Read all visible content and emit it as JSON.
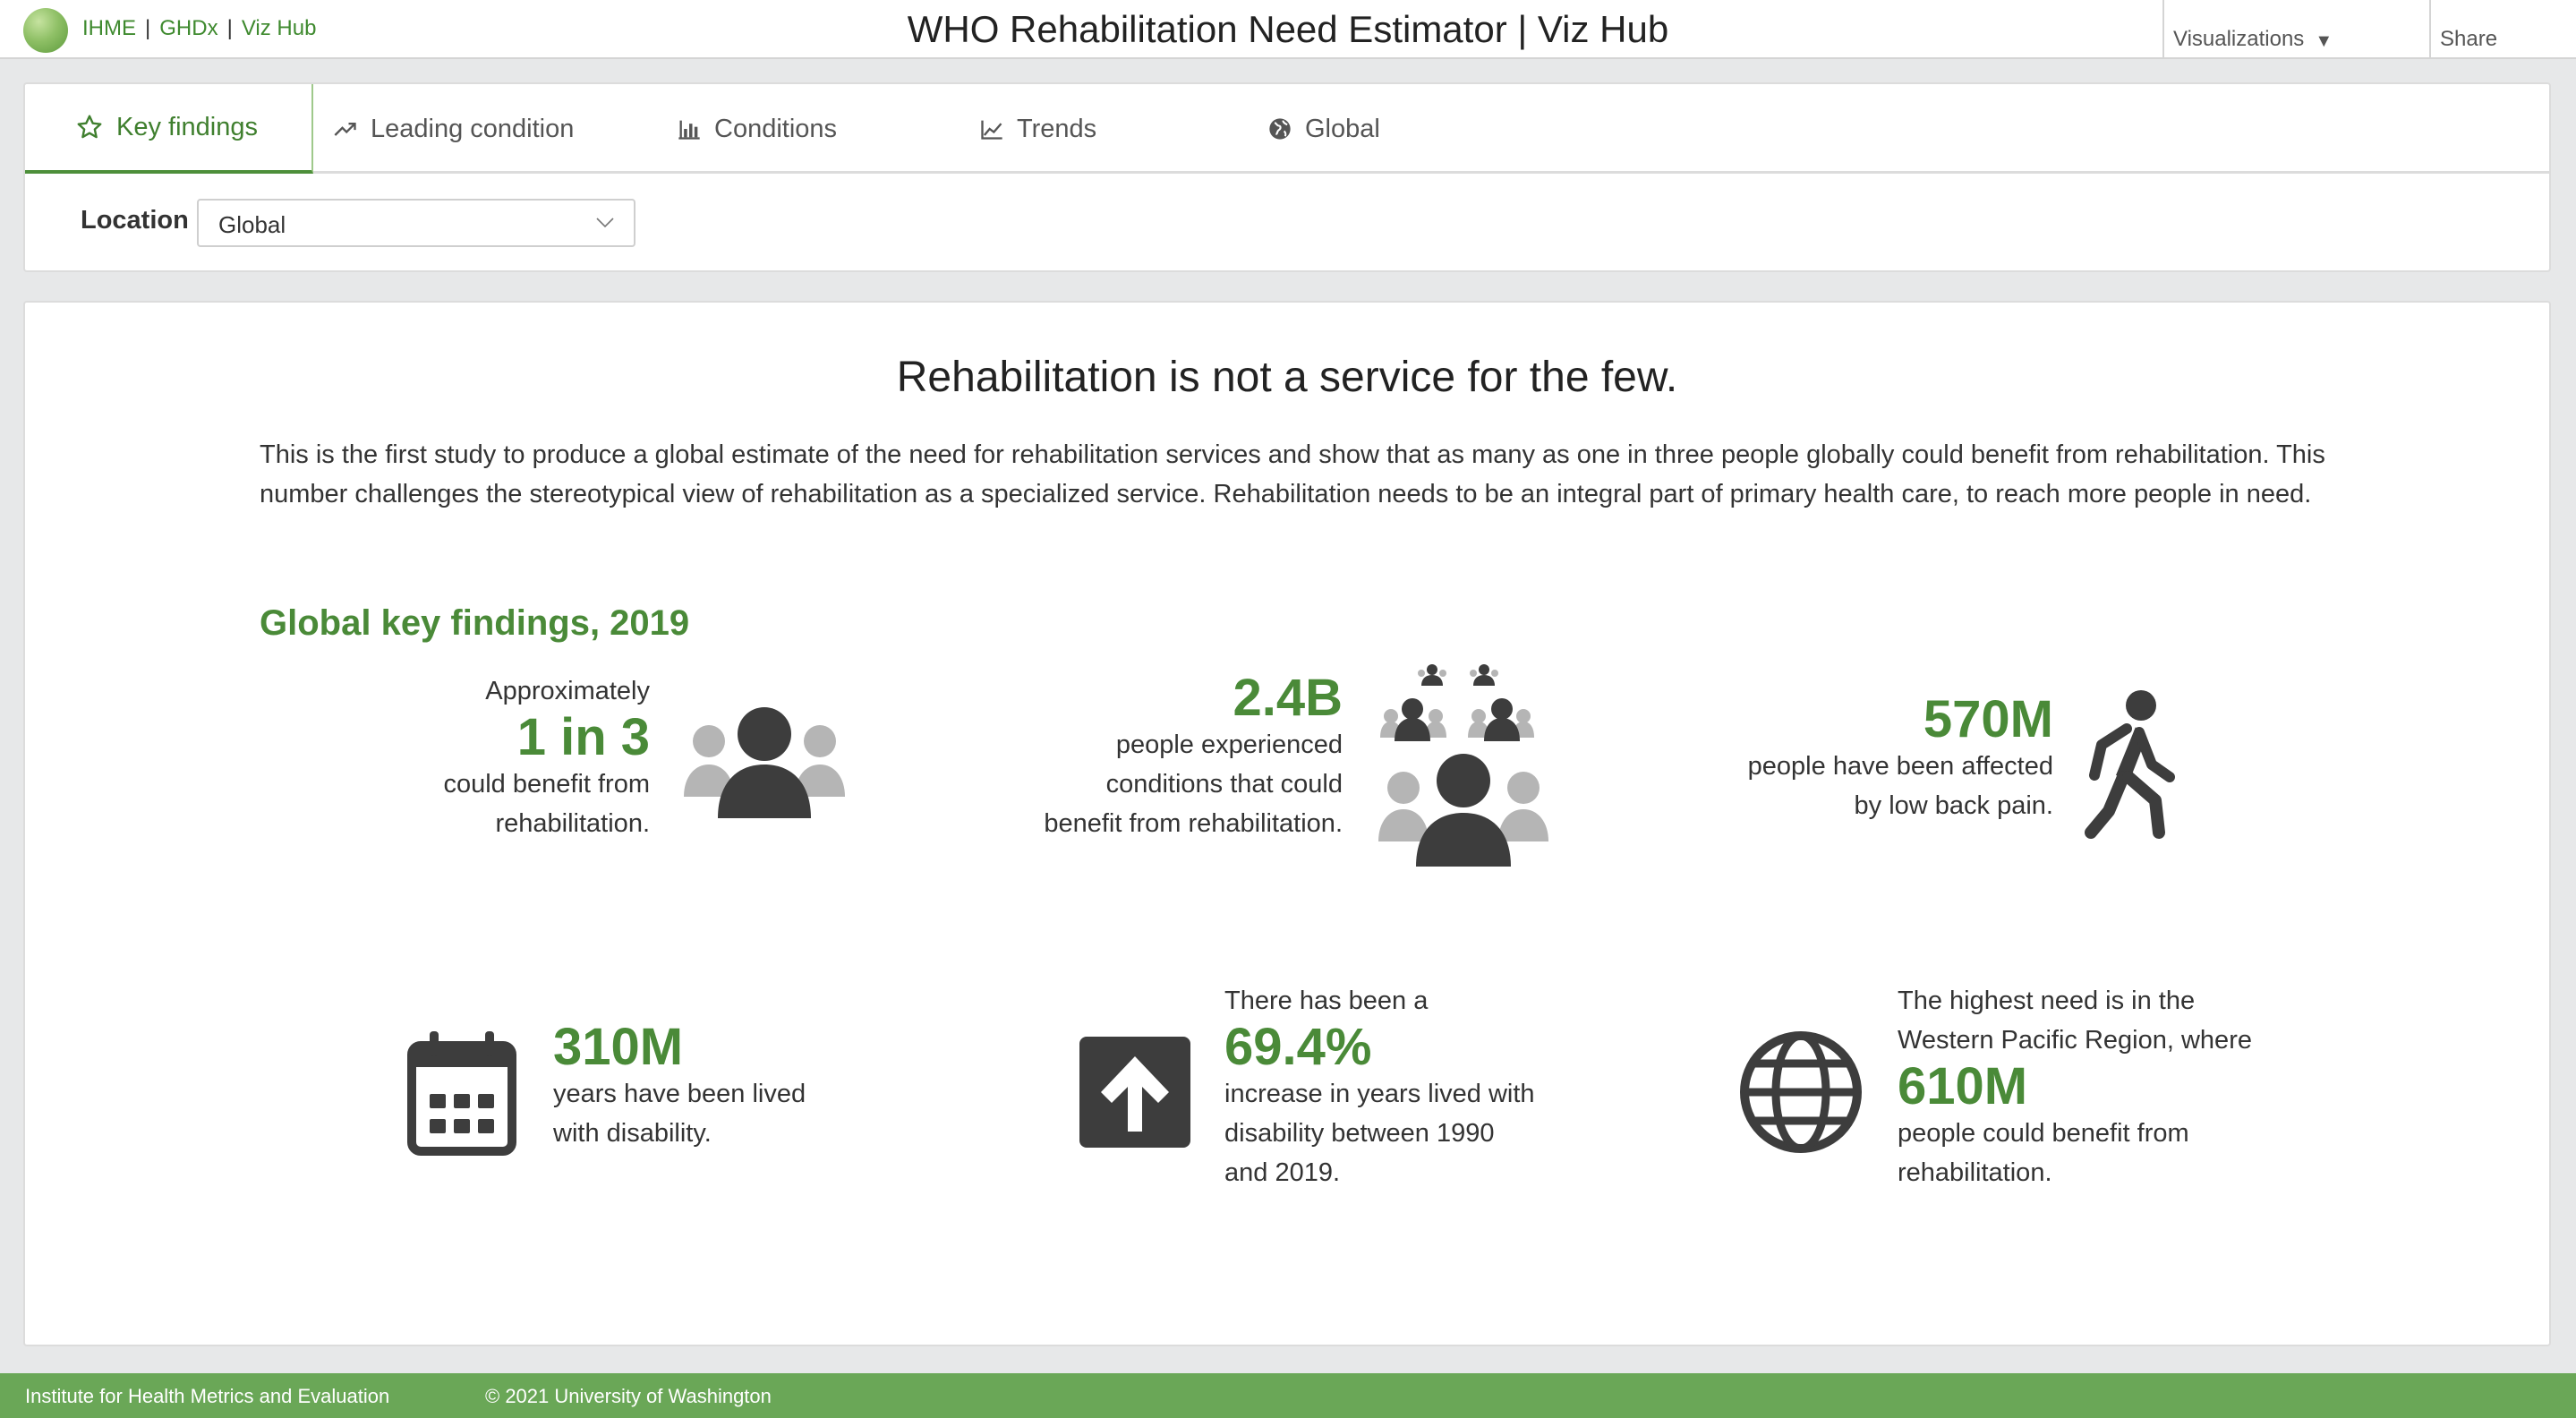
{
  "header": {
    "links": [
      "IHME",
      "GHDx",
      "Viz Hub"
    ],
    "separator": "|",
    "title": "WHO Rehabilitation Need Estimator | Viz Hub",
    "visualizations_label": "Visualizations",
    "share_label": "Share"
  },
  "tabs": [
    {
      "label": "Key findings",
      "icon": "star-icon",
      "active": true
    },
    {
      "label": "Leading condition",
      "icon": "trend-icon"
    },
    {
      "label": "Conditions",
      "icon": "bar-chart-icon"
    },
    {
      "label": "Trends",
      "icon": "line-chart-icon"
    },
    {
      "label": "Global",
      "icon": "globe-icon"
    }
  ],
  "filters": {
    "location_label": "Location",
    "location_value": "Global"
  },
  "main": {
    "headline": "Rehabilitation is not a service for the few.",
    "intro": "This is the first study to produce a global estimate of the need for rehabilitation services and show that as many as one in three people globally could benefit from rehabilitation. This number challenges the stereotypical view of rehabilitation as a specialized service. Rehabilitation needs to be an integral part of primary health care, to reach more people in need.",
    "section_title": "Global key findings, 2019",
    "stats": [
      {
        "pre": "Approximately",
        "value": "1 in 3",
        "post_1": "could benefit from",
        "post_2": "rehabilitation."
      },
      {
        "value": "2.4B",
        "post_1": "people experienced",
        "post_2": "conditions that could",
        "post_3": "benefit from rehabilitation."
      },
      {
        "value": "570M",
        "post_1": "people have been affected",
        "post_2": "by low back pain."
      },
      {
        "value": "310M",
        "post_1": "years have been lived",
        "post_2": "with disability."
      },
      {
        "pre": "There has been a",
        "value": "69.4%",
        "post_1": "increase in years lived with",
        "post_2": "disability between 1990",
        "post_3": "and 2019."
      },
      {
        "pre_1": "The highest need is in the",
        "pre_2": "Western Pacific Region, where",
        "value": "610M",
        "post_1": "people could benefit from",
        "post_2": "rehabilitation."
      }
    ]
  },
  "footer": {
    "org": "Institute for Health Metrics and Evaluation",
    "copyright": "© 2021 University of Washington"
  },
  "colors": {
    "accent": "#4a8a38",
    "footer": "#6aa757",
    "icon_dark": "#3d3d3d",
    "icon_light": "#b5b5b5"
  }
}
